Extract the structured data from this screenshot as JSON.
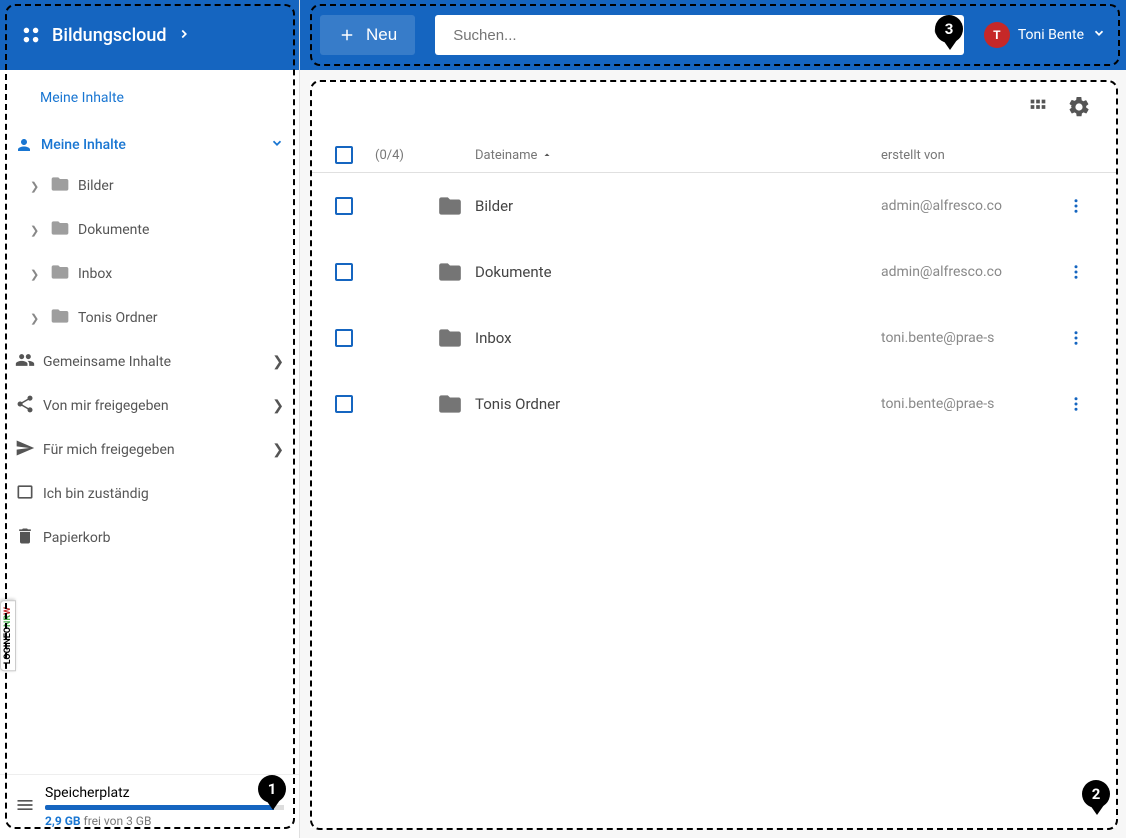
{
  "header": {
    "title": "Bildungscloud"
  },
  "topbar": {
    "new_label": "Neu",
    "search_placeholder": "Suchen...",
    "user_initial": "T",
    "user_name": "Toni Bente"
  },
  "sidebar": {
    "breadcrumb": "Meine Inhalte",
    "root": {
      "label": "Meine Inhalte"
    },
    "children": [
      {
        "label": "Bilder"
      },
      {
        "label": "Dokumente"
      },
      {
        "label": "Inbox"
      },
      {
        "label": "Tonis Ordner"
      }
    ],
    "nav": [
      {
        "label": "Gemeinsame Inhalte",
        "icon": "group"
      },
      {
        "label": "Von mir freigegeben",
        "icon": "share"
      },
      {
        "label": "Für mich freigegeben",
        "icon": "send"
      },
      {
        "label": "Ich bin zuständig",
        "icon": "square"
      },
      {
        "label": "Papierkorb",
        "icon": "trash"
      }
    ]
  },
  "storage": {
    "label": "Speicherplatz",
    "used": "2,9 GB",
    "rest": "frei von 3 GB"
  },
  "table": {
    "count": "(0/4)",
    "col_name": "Dateiname",
    "col_created": "erstellt von",
    "rows": [
      {
        "name": "Bilder",
        "created_by": "admin@alfresco.co"
      },
      {
        "name": "Dokumente",
        "created_by": "admin@alfresco.co"
      },
      {
        "name": "Inbox",
        "created_by": "toni.bente@prae-s"
      },
      {
        "name": "Tonis Ordner",
        "created_by": "toni.bente@prae-s"
      }
    ]
  },
  "sidetab": {
    "a": "LOGINEO",
    "b": "NR",
    "c": "W"
  },
  "annotations": {
    "pin1": "1",
    "pin2": "2",
    "pin3": "3"
  }
}
